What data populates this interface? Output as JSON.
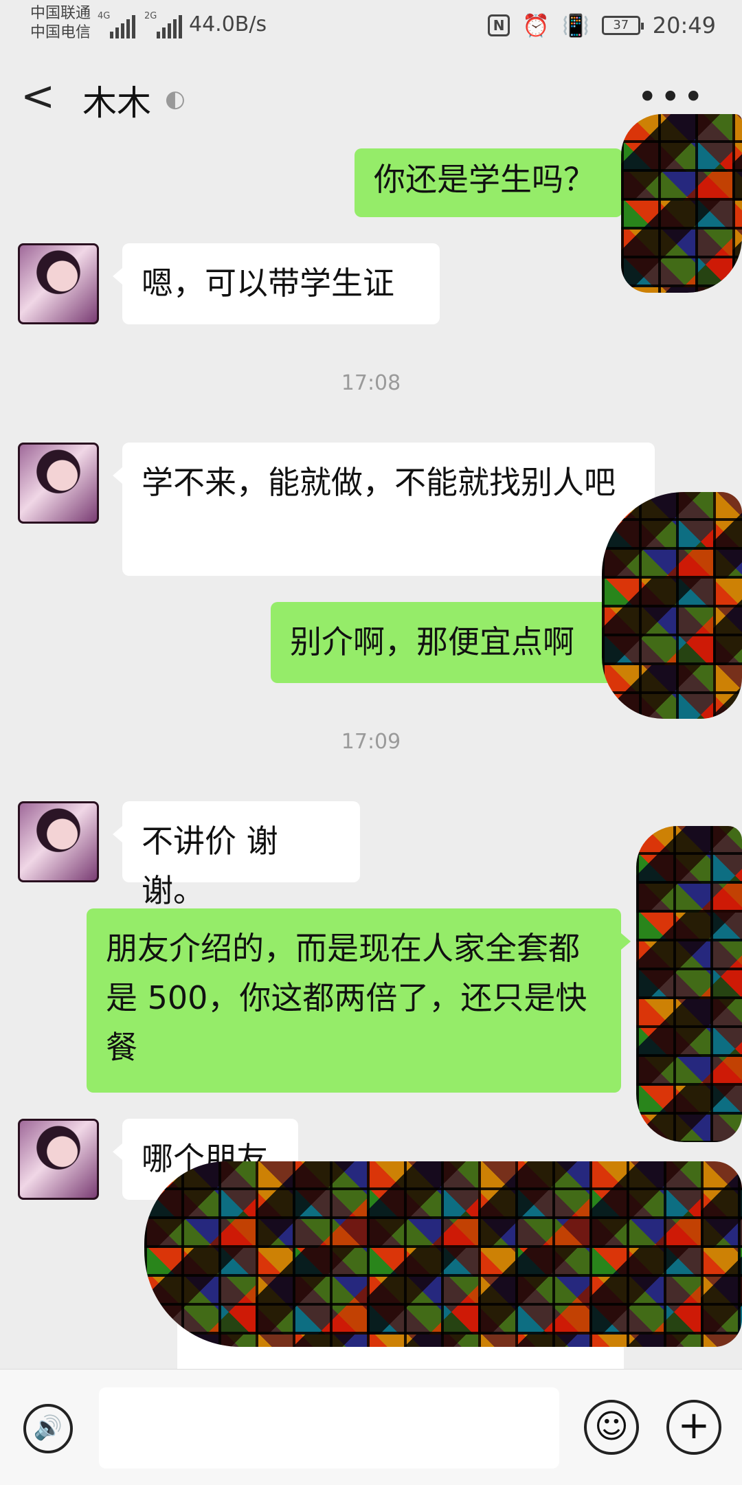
{
  "status_bar": {
    "carrier1": "中国联通",
    "carrier2": "中国电信",
    "sig1_tag": "4G",
    "sig2_tag": "2G",
    "speed": "44.0B/s",
    "battery": "37",
    "time": "20:49"
  },
  "nav": {
    "back_icon": "<",
    "title": "木木",
    "more_icon": "•••"
  },
  "messages": [
    {
      "side": "out",
      "text": "你还是学生吗？"
    },
    {
      "side": "in",
      "text": "嗯，可以带学生证"
    },
    {
      "type": "time",
      "text": "17:08"
    },
    {
      "side": "in",
      "text": "学不来，能就做，不能就找别人吧"
    },
    {
      "side": "out",
      "text": "别介啊，那便宜点啊"
    },
    {
      "type": "time",
      "text": "17:09"
    },
    {
      "side": "in",
      "text": "不讲价 谢谢。"
    },
    {
      "side": "out",
      "text": "朋友介绍的，而是现在人家全套都是 500，你这都两倍了，还只是快餐"
    },
    {
      "side": "in",
      "text": "哪个朋友"
    }
  ],
  "input_bar": {
    "emoji_icon": "☺",
    "plus_icon": "+",
    "voice_icon": "🔊",
    "text_value": ""
  },
  "colors": {
    "out_bubble": "#95ec69",
    "in_bubble": "#ffffff",
    "background": "#ededed"
  }
}
